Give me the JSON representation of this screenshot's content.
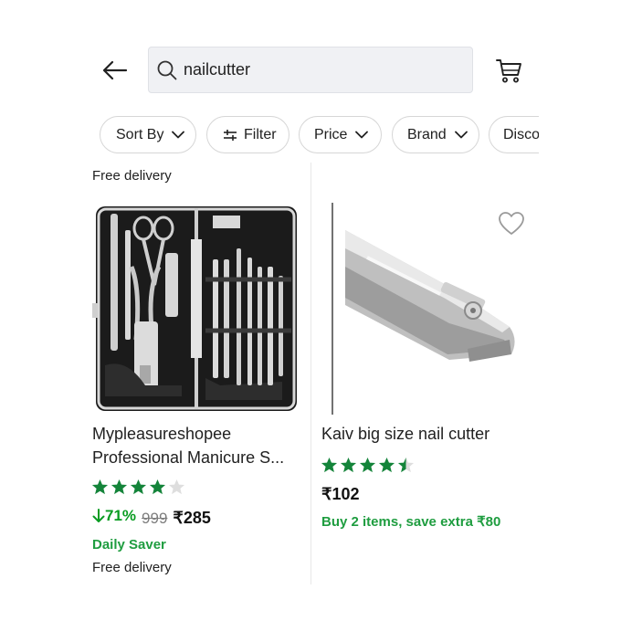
{
  "search": {
    "query": "nailcutter"
  },
  "filters": [
    {
      "label": "Sort By",
      "has_chevron": true
    },
    {
      "label": "Filter",
      "has_chevron": false
    },
    {
      "label": "Price",
      "has_chevron": true
    },
    {
      "label": "Brand",
      "has_chevron": true
    },
    {
      "label": "Disco",
      "has_chevron": false
    }
  ],
  "products": [
    {
      "top_note": "Free delivery",
      "name_line1": "Mypleasureshopee",
      "name_line2": "Professional Manicure S...",
      "rating": 4,
      "discount": "71%",
      "mrp": "999",
      "price": "₹285",
      "tag": "Daily Saver",
      "delivery": "Free delivery"
    },
    {
      "name_line1": "Kaiv big size nail cutter",
      "rating": 4.5,
      "price": "₹102",
      "offer": "Buy 2 items, save extra ₹80"
    }
  ],
  "colors": {
    "star_filled": "#14843a",
    "star_empty": "#dedede",
    "discount_green": "#0a9c22",
    "offer_green": "#1f9d40"
  },
  "icons": [
    "back-arrow-icon",
    "search-icon",
    "cart-icon",
    "chevron-down-icon",
    "sliders-icon",
    "heart-icon",
    "down-arrow-icon"
  ]
}
